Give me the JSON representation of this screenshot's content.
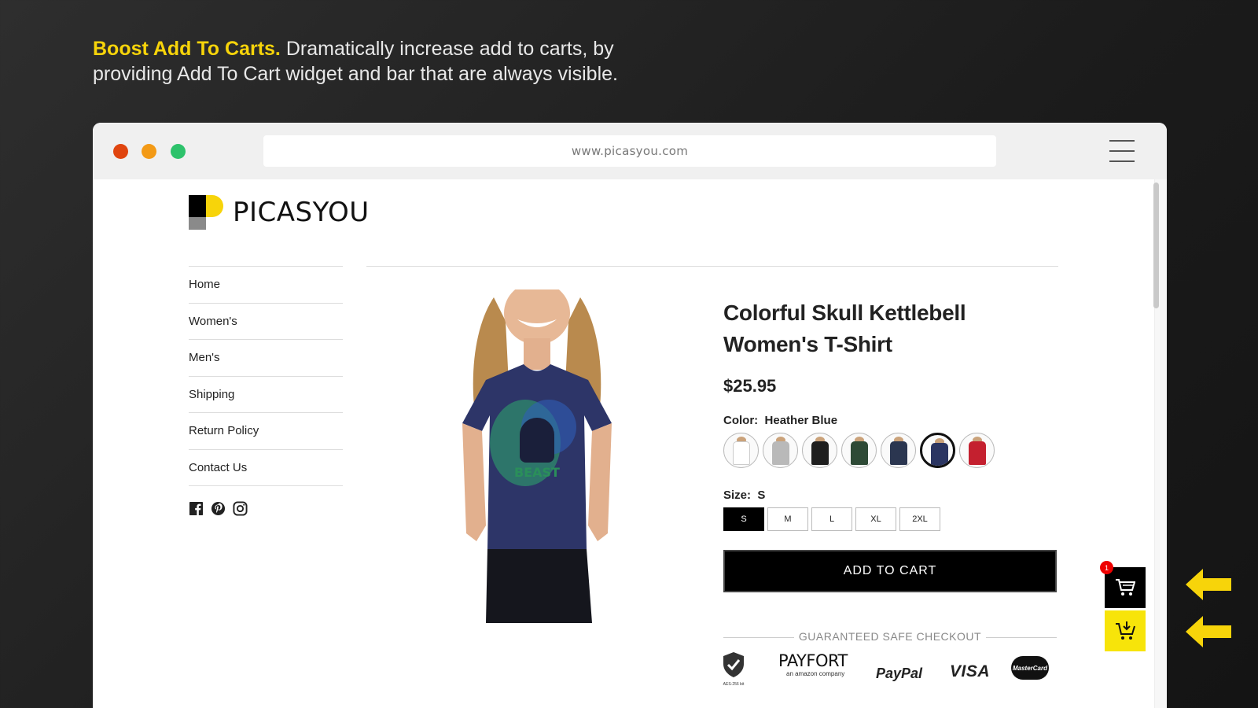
{
  "headline": {
    "strong": "Boost Add To Carts.",
    "text": " Dramatically increase add to carts, by providing Add To Cart widget and bar that are always visible."
  },
  "browser": {
    "url": "www.picasyou.com"
  },
  "store": {
    "logo_text": "PICASYOU",
    "nav": [
      "Home",
      "Women's",
      "Men's",
      "Shipping",
      "Return Policy",
      "Contact Us"
    ],
    "socials": [
      "facebook-icon",
      "pinterest-icon",
      "instagram-icon"
    ]
  },
  "product": {
    "title": "Colorful Skull Kettlebell Women's T-Shirt",
    "price": "$25.95",
    "color_label": "Color:",
    "color_value": "Heather Blue",
    "swatches": [
      {
        "color": "#ffffff"
      },
      {
        "color": "#b9b9b9"
      },
      {
        "color": "#1f1f1f"
      },
      {
        "color": "#2e4a36"
      },
      {
        "color": "#2b3650"
      },
      {
        "color": "#2b3562",
        "selected": true
      },
      {
        "color": "#c4202f"
      }
    ],
    "size_label": "Size:",
    "size_value": "S",
    "sizes": [
      "S",
      "M",
      "L",
      "XL",
      "2XL"
    ],
    "selected_size": "S",
    "add_to_cart": "ADD TO CART",
    "safe_checkout": "GUARANTEED SAFE CHECKOUT",
    "payments": {
      "secure": "AES-256 bit",
      "payfort": "PAYFORT",
      "payfort_sub": "an amazon company",
      "paypal": "PayPal",
      "visa": "VISA",
      "mastercard": "MasterCard"
    }
  },
  "widgets": {
    "cart_count": "1"
  },
  "colors": {
    "accent_yellow": "#f7d40a",
    "badge_red": "#e00000"
  }
}
